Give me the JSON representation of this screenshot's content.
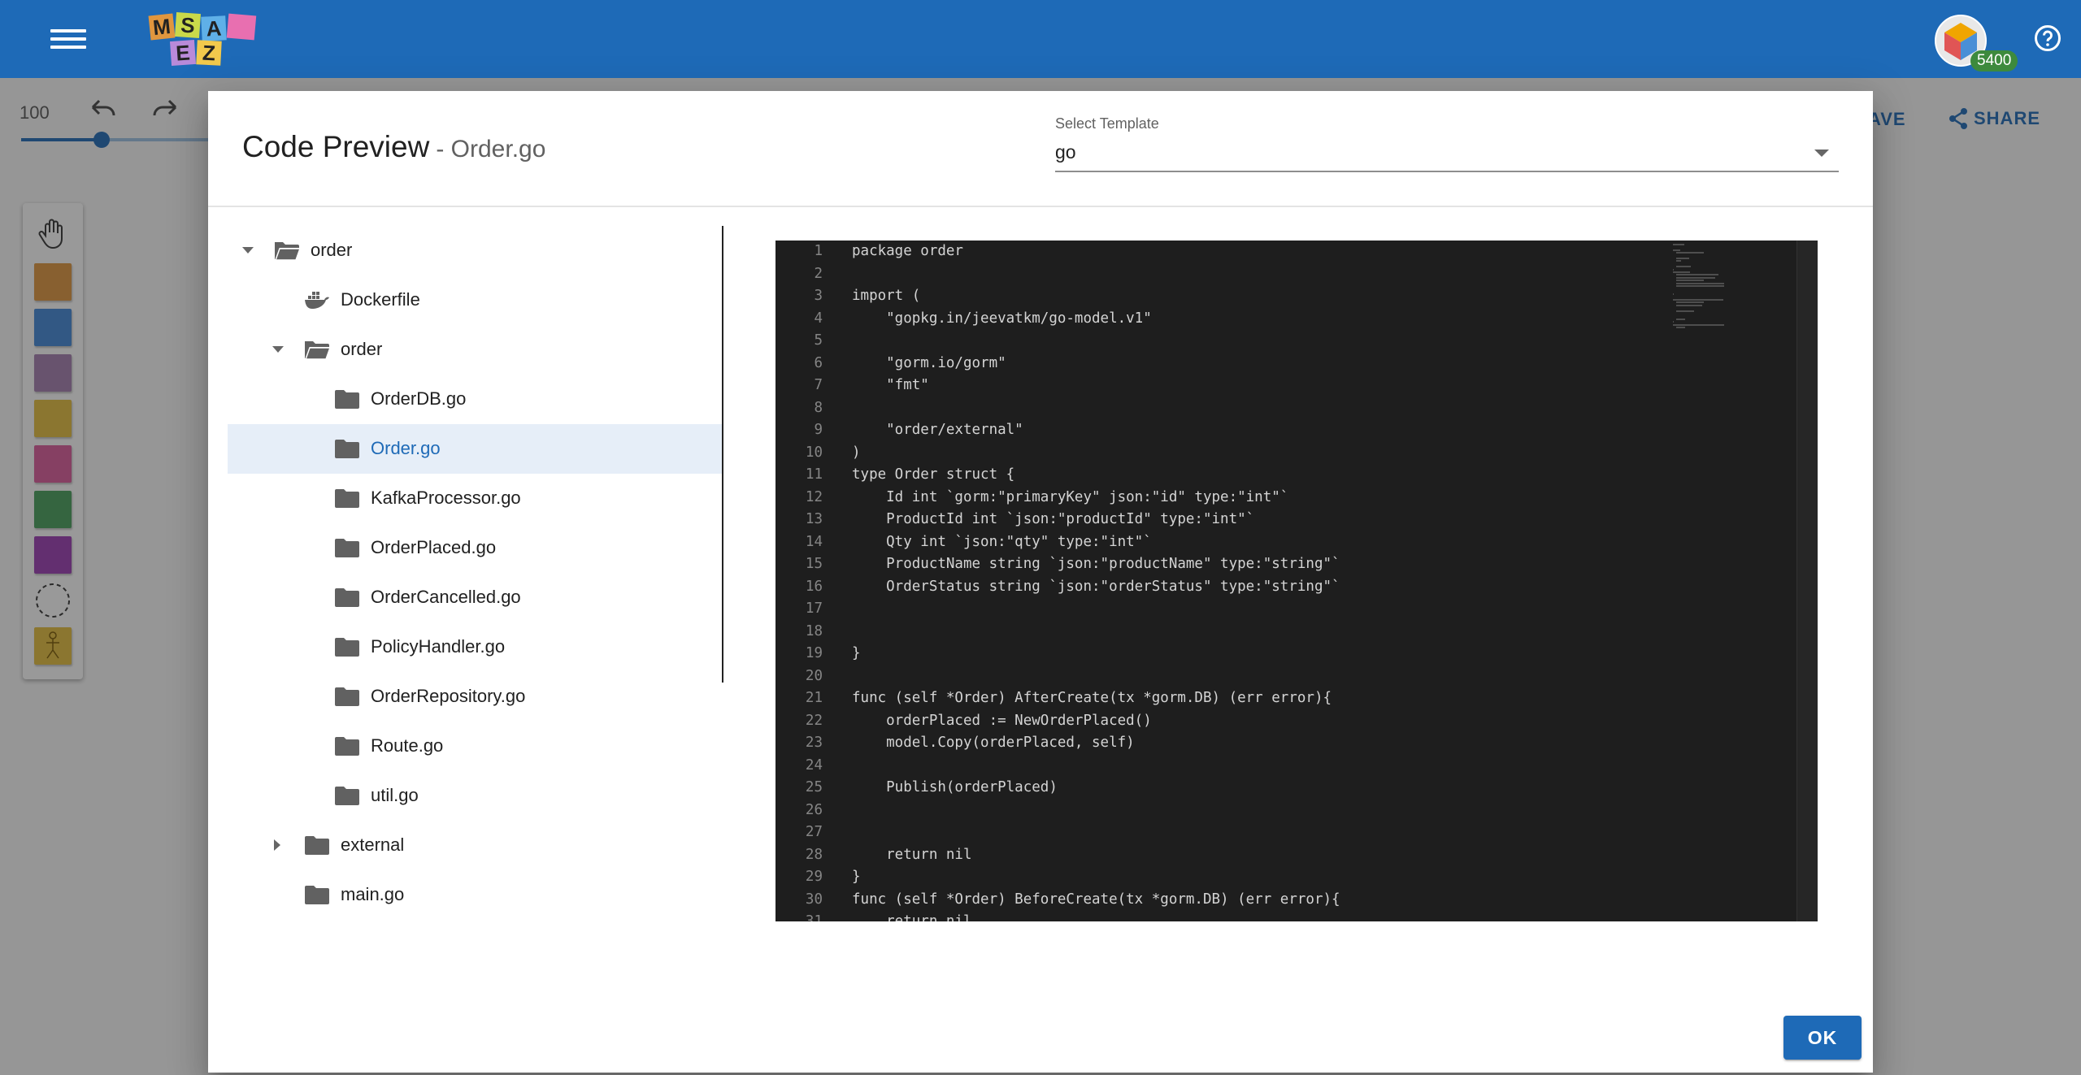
{
  "app": {
    "logo_letters": [
      "M",
      "S",
      "A",
      "E",
      "Z"
    ],
    "coin_count": "5400"
  },
  "editor_bg": {
    "zoom_value": "100",
    "zoom_level": 0.43,
    "save_label": "AVE",
    "share_label": "SHARE",
    "palette_colors": [
      "#e0963e",
      "#4187d9",
      "#a57fb0",
      "#e6be3e",
      "#dc5c9c",
      "#46a05c",
      "#9b3cb4"
    ]
  },
  "dialog": {
    "title": "Code Preview",
    "subtitle": "- Order.go",
    "template_label": "Select Template",
    "template_value": "go",
    "ok_label": "OK"
  },
  "tree": [
    {
      "label": "order",
      "icon": "folder-open-icon",
      "arrow": "down",
      "depth": 0
    },
    {
      "label": "Dockerfile",
      "icon": "docker-icon",
      "arrow": "none",
      "depth": 1
    },
    {
      "label": "order",
      "icon": "folder-open-icon",
      "arrow": "down",
      "depth": 1
    },
    {
      "label": "OrderDB.go",
      "icon": "folder-icon",
      "arrow": "none",
      "depth": 2
    },
    {
      "label": "Order.go",
      "icon": "folder-icon",
      "arrow": "none",
      "depth": 2,
      "selected": true
    },
    {
      "label": "KafkaProcessor.go",
      "icon": "folder-icon",
      "arrow": "none",
      "depth": 2
    },
    {
      "label": "OrderPlaced.go",
      "icon": "folder-icon",
      "arrow": "none",
      "depth": 2
    },
    {
      "label": "OrderCancelled.go",
      "icon": "folder-icon",
      "arrow": "none",
      "depth": 2
    },
    {
      "label": "PolicyHandler.go",
      "icon": "folder-icon",
      "arrow": "none",
      "depth": 2
    },
    {
      "label": "OrderRepository.go",
      "icon": "folder-icon",
      "arrow": "none",
      "depth": 2
    },
    {
      "label": "Route.go",
      "icon": "folder-icon",
      "arrow": "none",
      "depth": 2
    },
    {
      "label": "util.go",
      "icon": "folder-icon",
      "arrow": "none",
      "depth": 2
    },
    {
      "label": "external",
      "icon": "folder-icon",
      "arrow": "right",
      "depth": 1
    },
    {
      "label": "main.go",
      "icon": "folder-icon",
      "arrow": "none",
      "depth": 1
    }
  ],
  "code_lines": [
    "package order",
    "",
    "import (",
    "    \"gopkg.in/jeevatkm/go-model.v1\"",
    "",
    "    \"gorm.io/gorm\"",
    "    \"fmt\"",
    "",
    "    \"order/external\"",
    ")",
    "type Order struct {",
    "    Id int `gorm:\"primaryKey\" json:\"id\" type:\"int\"`",
    "    ProductId int `json:\"productId\" type:\"int\"`",
    "    Qty int `json:\"qty\" type:\"int\"`",
    "    ProductName string `json:\"productName\" type:\"string\"`",
    "    OrderStatus string `json:\"orderStatus\" type:\"string\"`",
    "",
    "",
    "}",
    "",
    "func (self *Order) AfterCreate(tx *gorm.DB) (err error){",
    "    orderPlaced := NewOrderPlaced()",
    "    model.Copy(orderPlaced, self)",
    "",
    "    Publish(orderPlaced)",
    "",
    "",
    "    return nil",
    "}",
    "func (self *Order) BeforeCreate(tx *gorm.DB) (err error){",
    "    return nil"
  ]
}
